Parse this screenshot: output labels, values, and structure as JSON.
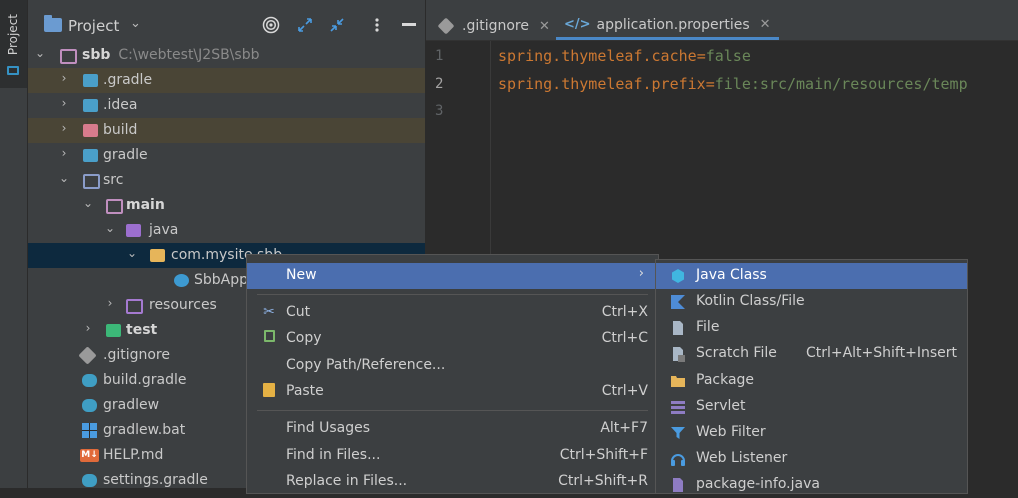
{
  "sidebar_strip": {
    "label": "Project"
  },
  "project_panel": {
    "title": "Project",
    "tree": {
      "root": {
        "name": "sbb",
        "path": "C:\\webtest\\J2SB\\sbb"
      },
      "items": [
        {
          "label": ".gradle",
          "icon": "folder-icon"
        },
        {
          "label": ".idea",
          "icon": "folder-icon"
        },
        {
          "label": "build",
          "icon": "folder-icon"
        },
        {
          "label": "gradle",
          "icon": "folder-icon"
        },
        {
          "label": "src",
          "icon": "folder-icon"
        },
        {
          "label": "main",
          "icon": "folder-icon"
        },
        {
          "label": "java",
          "icon": "folder-icon"
        },
        {
          "label": "com.mysite.sbb",
          "icon": "package-icon"
        },
        {
          "label": "SbbApplication",
          "icon": "class-icon"
        },
        {
          "label": "resources",
          "icon": "folder-icon"
        },
        {
          "label": "test",
          "icon": "folder-icon"
        },
        {
          "label": ".gitignore",
          "icon": "git-icon"
        },
        {
          "label": "build.gradle",
          "icon": "gradle-icon"
        },
        {
          "label": "gradlew",
          "icon": "gradle-icon"
        },
        {
          "label": "gradlew.bat",
          "icon": "windows-icon"
        },
        {
          "label": "HELP.md",
          "icon": "markdown-icon"
        },
        {
          "label": "settings.gradle",
          "icon": "gradle-icon"
        }
      ]
    }
  },
  "editor": {
    "tabs": [
      {
        "label": ".gitignore",
        "active": false
      },
      {
        "label": "application.properties",
        "active": true
      }
    ],
    "lines": [
      {
        "number": "1",
        "key": "spring.thymeleaf.cache",
        "eq": "=",
        "value": "false"
      },
      {
        "number": "2",
        "key": "spring.thymeleaf.prefix",
        "eq": "=",
        "value": "file:src/main/resources/temp"
      },
      {
        "number": "3",
        "key": "",
        "eq": "",
        "value": ""
      }
    ]
  },
  "context_menu": {
    "items": [
      {
        "label": "New",
        "shortcut": "",
        "submenu": true
      },
      {
        "label": "Cut",
        "shortcut": "Ctrl+X",
        "icon": "scissors-icon"
      },
      {
        "label": "Copy",
        "shortcut": "Ctrl+C",
        "icon": "copy-icon"
      },
      {
        "label": "Copy Path/Reference...",
        "shortcut": ""
      },
      {
        "label": "Paste",
        "shortcut": "Ctrl+V",
        "icon": "paste-icon"
      },
      {
        "label": "Find Usages",
        "shortcut": "Alt+F7"
      },
      {
        "label": "Find in Files...",
        "shortcut": "Ctrl+Shift+F"
      },
      {
        "label": "Replace in Files...",
        "shortcut": "Ctrl+Shift+R"
      }
    ],
    "submenu_arrow": "›"
  },
  "new_submenu": {
    "items": [
      {
        "label": "Java Class",
        "shortcut": "",
        "icon": "java-class-icon"
      },
      {
        "label": "Kotlin Class/File",
        "shortcut": "",
        "icon": "kotlin-icon"
      },
      {
        "label": "File",
        "shortcut": "",
        "icon": "file-icon"
      },
      {
        "label": "Scratch File",
        "shortcut": "Ctrl+Alt+Shift+Insert",
        "icon": "scratch-file-icon"
      },
      {
        "label": "Package",
        "shortcut": "",
        "icon": "package-icon"
      },
      {
        "label": "Servlet",
        "shortcut": "",
        "icon": "servlet-icon"
      },
      {
        "label": "Web Filter",
        "shortcut": "",
        "icon": "filter-icon"
      },
      {
        "label": "Web Listener",
        "shortcut": "",
        "icon": "listener-icon"
      },
      {
        "label": "package-info.java",
        "shortcut": "",
        "icon": "java-file-icon"
      }
    ]
  },
  "colors": {
    "selection": "#4b6eaf",
    "keyword": "#cc7832",
    "string": "#6a8759"
  }
}
